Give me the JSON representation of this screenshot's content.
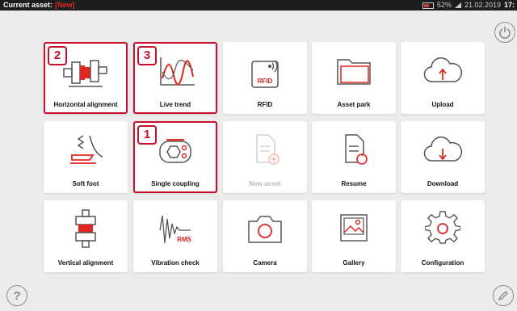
{
  "status": {
    "asset_label": "Current asset:",
    "asset_value": "[New]",
    "battery": "52%",
    "date": "21.02.2019",
    "time": "17:"
  },
  "tiles": {
    "horizontal_alignment": {
      "label": "Horizontal alignment",
      "badge": "2"
    },
    "live_trend": {
      "label": "Live trend",
      "badge": "3"
    },
    "rfid": {
      "label": "RFID",
      "icon_text": "RFID"
    },
    "asset_park": {
      "label": "Asset park"
    },
    "upload": {
      "label": "Upload"
    },
    "soft_foot": {
      "label": "Soft foot"
    },
    "single_coupling": {
      "label": "Single coupling",
      "badge": "1"
    },
    "new_asset": {
      "label": "New asset"
    },
    "resume": {
      "label": "Resume"
    },
    "download": {
      "label": "Download"
    },
    "vertical_alignment": {
      "label": "Vertical alignment"
    },
    "vibration_check": {
      "label": "Vibration check",
      "icon_text": "RMS"
    },
    "camera": {
      "label": "Camera"
    },
    "gallery": {
      "label": "Gallery"
    },
    "configuration": {
      "label": "Configuration"
    }
  },
  "colors": {
    "accent": "#c8102e",
    "icon_gray": "#555555",
    "background": "#ececec"
  }
}
